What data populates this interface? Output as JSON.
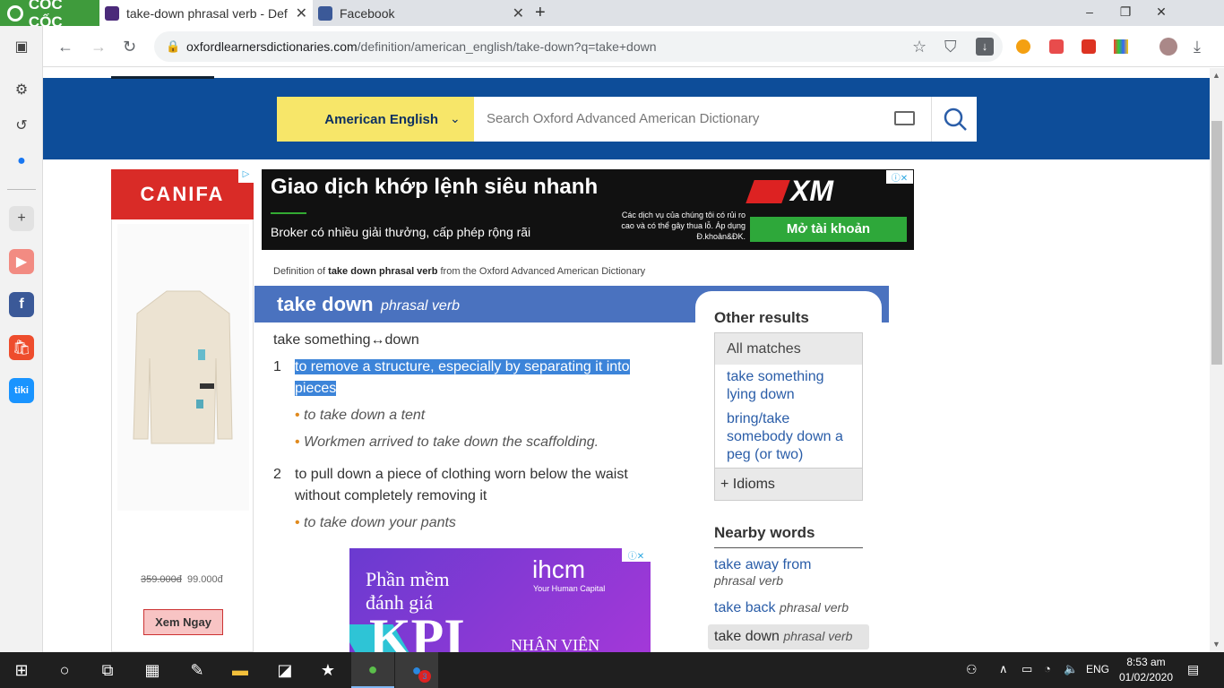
{
  "browser": {
    "brand": "CỐC CỐC",
    "tabs": [
      {
        "title": "take-down phrasal verb - Def"
      },
      {
        "title": "Facebook"
      }
    ],
    "url_host": "oxfordlearnersdictionaries.com",
    "url_path": "/definition/american_english/take-down?q=take+down"
  },
  "site": {
    "dictionary_select": "American English",
    "search_placeholder": "Search Oxford Advanced American Dictionary"
  },
  "ads": {
    "canifa_brand": "CANIFA",
    "canifa_old_price": "359.000đ",
    "canifa_new_price": "99.000đ",
    "canifa_cta": "Xem Ngay",
    "xm_headline": "Giao dịch khớp lệnh siêu nhanh",
    "xm_sub": "Broker có nhiều giải thưởng, cấp phép rộng rãi",
    "xm_risk": "Các dịch vụ của chúng tôi có rủi ro cao và có thể gây thua lỗ. Áp dụng Đ.khoản&ĐK.",
    "xm_logo": "XM",
    "xm_cta": "Mở tài khoản",
    "kpi_line1": "Phần mềm",
    "kpi_line2": "đánh giá",
    "kpi_big": "KPI",
    "kpi_tail": "NHÂN VIÊN",
    "kpi_brand": "ihcm",
    "kpi_brand_sub": "Your Human Capital"
  },
  "entry": {
    "breadcrumb_pre": "Definition of ",
    "breadcrumb_bold": "take down phrasal verb",
    "breadcrumb_post": " from the Oxford Advanced American Dictionary",
    "headword": "take down",
    "pos": "phrasal verb",
    "pattern": "take something↔down",
    "senses": [
      {
        "num": "1",
        "def": "to remove a structure, especially by separating it into pieces",
        "examples": [
          "to take down a tent",
          "Workmen arrived to take down the scaffolding."
        ]
      },
      {
        "num": "2",
        "def": "to pull down a piece of clothing worn below the waist without completely removing it",
        "examples": [
          "to take down your pants"
        ]
      }
    ]
  },
  "sidebar_panel": {
    "other_results": "Other results",
    "all_matches": "All matches",
    "matches": [
      "take something lying down",
      "bring/take somebody down a peg (or two)"
    ],
    "idioms": "Idioms",
    "nearby_title": "Nearby words",
    "nearby": [
      {
        "word": "take away from",
        "pos": "phrasal verb"
      },
      {
        "word": "take back",
        "pos": "phrasal verb"
      },
      {
        "word": "take down",
        "pos": "phrasal verb"
      }
    ]
  },
  "taskbar": {
    "lang": "ENG",
    "time": "8:53 am",
    "date": "01/02/2020",
    "zalo_badge": "3"
  }
}
